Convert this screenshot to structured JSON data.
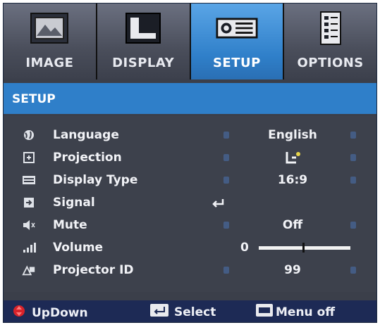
{
  "tabs": [
    {
      "label": "IMAGE",
      "icon": "image-icon",
      "active": false
    },
    {
      "label": "DISPLAY",
      "icon": "display-icon",
      "active": false
    },
    {
      "label": "SETUP",
      "icon": "setup-icon",
      "active": true
    },
    {
      "label": "OPTIONS",
      "icon": "options-icon",
      "active": false
    }
  ],
  "section_title": "SETUP",
  "rows": [
    {
      "label": "Language",
      "value": "English",
      "icon": "globe-icon"
    },
    {
      "label": "Projection",
      "value": "",
      "icon": "projection-icon"
    },
    {
      "label": "Display Type",
      "value": "16:9",
      "icon": "display-type-icon"
    },
    {
      "label": "Signal",
      "value": "",
      "icon": "signal-icon"
    },
    {
      "label": "Mute",
      "value": "Off",
      "icon": "mute-icon"
    },
    {
      "label": "Volume",
      "value": "0",
      "icon": "volume-icon",
      "level": 0.48
    },
    {
      "label": "Projector ID",
      "value": "99",
      "icon": "projector-id-icon"
    }
  ],
  "footer": {
    "updown": "UpDown",
    "select": "Select",
    "menu_off": "Menu off"
  },
  "colors": {
    "active_tab": "#2f7fc9",
    "footer_bg": "#1d2a55",
    "panel_bg": "#3d414c"
  }
}
